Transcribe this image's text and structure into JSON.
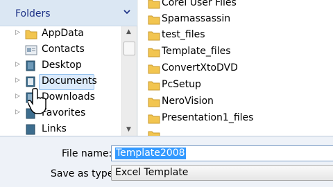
{
  "nav": {
    "header": "Folders",
    "items": [
      {
        "label": "AppData",
        "icon": "folder-icon"
      },
      {
        "label": "Contacts",
        "icon": "contacts-icon"
      },
      {
        "label": "Desktop",
        "icon": "desktop-icon"
      },
      {
        "label": "Documents",
        "icon": "documents-icon"
      },
      {
        "label": "Downloads",
        "icon": "downloads-icon"
      },
      {
        "label": "Favorites",
        "icon": "favorites-icon"
      },
      {
        "label": "Links",
        "icon": "links-icon"
      }
    ]
  },
  "files": [
    "Corel User Files",
    "Spamassassin",
    "test_files",
    "Template_files",
    "ConvertXtoDVD",
    "PcSetup",
    "NeroVision",
    "Presentation1_files"
  ],
  "form": {
    "file_name_label": "File name:",
    "file_name_value": "Template2008",
    "save_as_type_label": "Save as type:",
    "save_as_type_value": "Excel Template"
  },
  "colors": {
    "header_text": "#1e3287",
    "folder_yellow": "#f2c550",
    "selection": "#3399ff"
  }
}
